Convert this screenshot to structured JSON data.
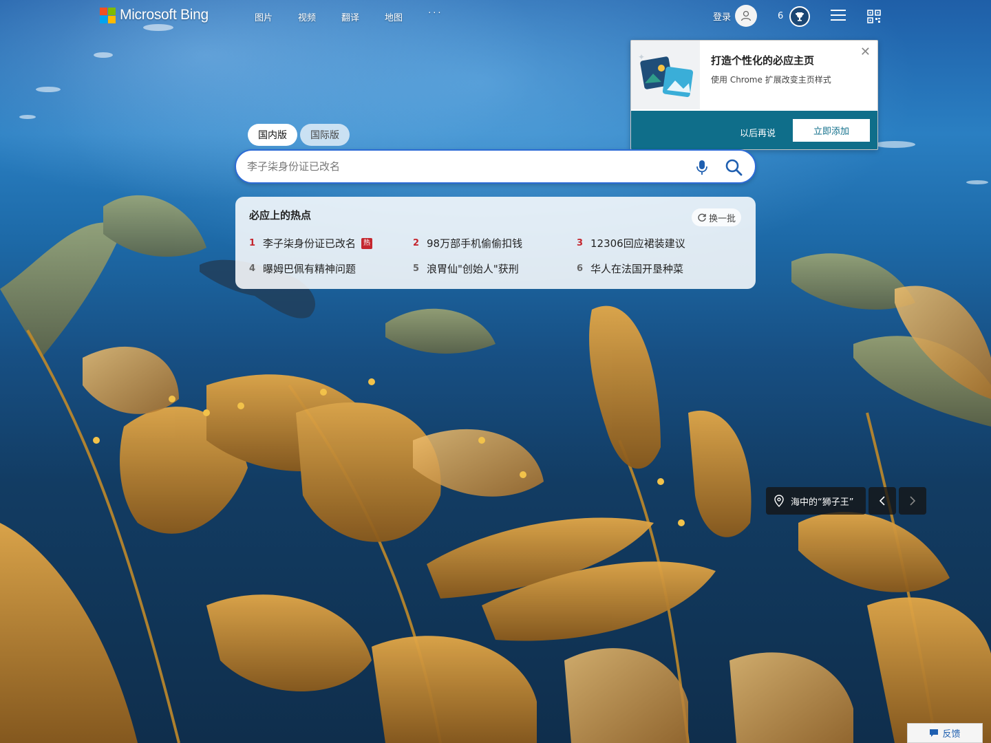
{
  "brand": {
    "name": "Microsoft Bing"
  },
  "nav": {
    "items": [
      {
        "label": "图片"
      },
      {
        "label": "视频"
      },
      {
        "label": "翻译"
      },
      {
        "label": "地图"
      }
    ],
    "more_label": "···"
  },
  "account": {
    "login_label": "登录",
    "rewards_points": "6"
  },
  "promo": {
    "title": "打造个性化的必应主页",
    "subtitle": "使用 Chrome 扩展改变主页样式",
    "close_label": "✕",
    "later_label": "以后再说",
    "add_label": "立即添加",
    "accent_color": "#0f6e8a"
  },
  "search": {
    "tabs": [
      {
        "label": "国内版",
        "active": true
      },
      {
        "label": "国际版",
        "active": false
      }
    ],
    "placeholder": "李子柒身份证已改名",
    "border_color": "#2c6bd6"
  },
  "hot_topics": {
    "title": "必应上的热点",
    "refresh_label": "换一批",
    "badge_label": "热",
    "items": [
      {
        "rank": "1",
        "text": "李子柒身份证已改名",
        "hot": true
      },
      {
        "rank": "2",
        "text": "98万部手机偷偷扣钱",
        "hot": false
      },
      {
        "rank": "3",
        "text": "12306回应裙装建议",
        "hot": false
      },
      {
        "rank": "4",
        "text": "曝姆巴佩有精神问题",
        "hot": false
      },
      {
        "rank": "5",
        "text": "浪胃仙\"创始人\"获刑",
        "hot": false
      },
      {
        "rank": "6",
        "text": "华人在法国开垦种菜",
        "hot": false
      }
    ],
    "rank_red_color": "#c4262e"
  },
  "image_info": {
    "caption": "海中的“狮子王”"
  },
  "feedback": {
    "label": "反馈"
  }
}
